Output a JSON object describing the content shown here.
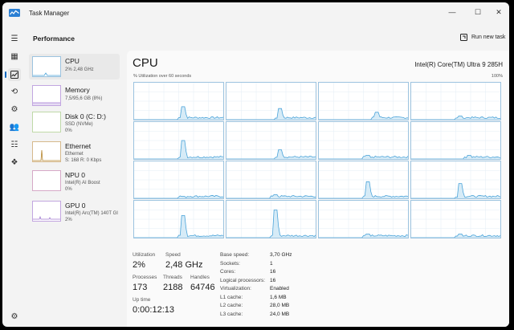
{
  "window": {
    "title": "Task Manager",
    "minimize": "—",
    "maximize": "☐",
    "close": "✕"
  },
  "rail": {
    "icons": [
      "hamburger-icon",
      "processes-icon",
      "performance-icon",
      "app-history-icon",
      "startup-icon",
      "users-icon",
      "details-icon",
      "services-icon",
      "settings-icon"
    ]
  },
  "header": {
    "title": "Performance",
    "run_new_task": "Run new task"
  },
  "sidebar": {
    "items": [
      {
        "name": "CPU",
        "sub1": "2% 2,48 GHz",
        "sub2": ""
      },
      {
        "name": "Memory",
        "sub1": "7,5/95,6 GB (8%)",
        "sub2": ""
      },
      {
        "name": "Disk 0 (C: D:)",
        "sub1": "SSD (NVMe)",
        "sub2": "0%"
      },
      {
        "name": "Ethernet",
        "sub1": "Ethernet",
        "sub2": "S: 168 R: 0 Kbps"
      },
      {
        "name": "NPU 0",
        "sub1": "Intel(R) AI Boost",
        "sub2": "0%"
      },
      {
        "name": "GPU 0",
        "sub1": "Intel(R) Arc(TM) 140T GI",
        "sub2": "2%"
      }
    ]
  },
  "main": {
    "title": "CPU",
    "model": "Intel(R) Core(TM) Ultra 9 285H",
    "util_label": "% Utilization over 60 seconds",
    "max_label": "100%"
  },
  "stats": {
    "utilization_label": "Utilization",
    "utilization": "2%",
    "speed_label": "Speed",
    "speed": "2,48 GHz",
    "processes_label": "Processes",
    "processes": "173",
    "threads_label": "Threads",
    "threads": "2188",
    "handles_label": "Handles",
    "handles": "64746",
    "uptime_label": "Up time",
    "uptime": "0:00:12:13"
  },
  "info": [
    {
      "label": "Base speed:",
      "value": "3,70 GHz"
    },
    {
      "label": "Sockets:",
      "value": "1"
    },
    {
      "label": "Cores:",
      "value": "16"
    },
    {
      "label": "Logical processors:",
      "value": "16"
    },
    {
      "label": "Virtualization:",
      "value": "Enabled"
    },
    {
      "label": "L1 cache:",
      "value": "1,6 MB"
    },
    {
      "label": "L2 cache:",
      "value": "28,0 MB"
    },
    {
      "label": "L3 cache:",
      "value": "24,0 MB"
    }
  ],
  "colors": {
    "accent": "#0067c0",
    "cpu_line": "#4aa3d9",
    "cpu_fill": "#d6ebf7"
  }
}
